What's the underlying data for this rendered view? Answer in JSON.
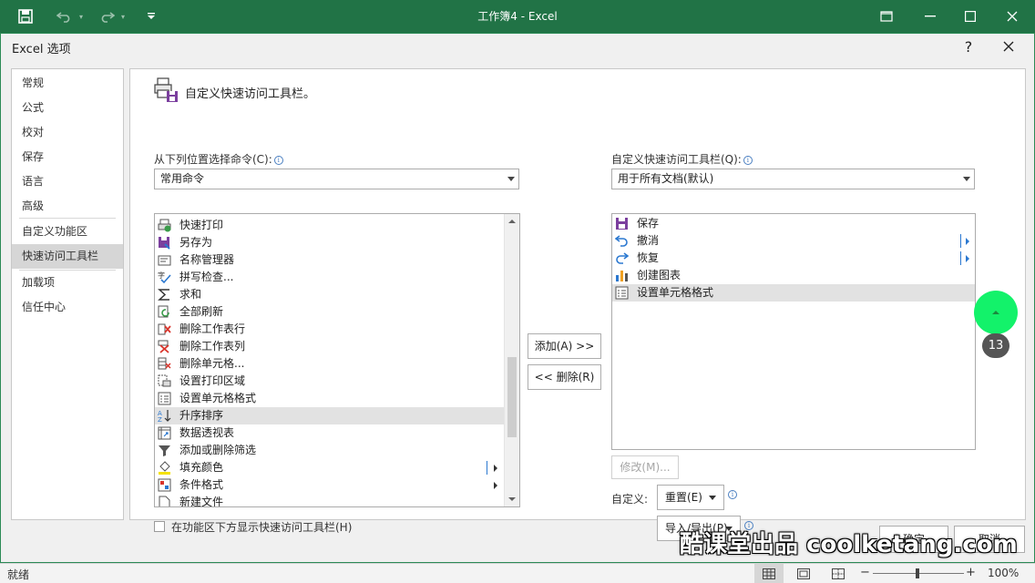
{
  "window": {
    "title": "工作簿4 - Excel",
    "accent_color": "#217346"
  },
  "dialog": {
    "title": "Excel 选项",
    "help_label": "?",
    "close_label": "✕"
  },
  "nav": {
    "items": [
      {
        "label": "常规"
      },
      {
        "label": "公式"
      },
      {
        "label": "校对"
      },
      {
        "label": "保存"
      },
      {
        "label": "语言"
      },
      {
        "label": "高级"
      },
      {
        "label": "自定义功能区"
      },
      {
        "label": "快速访问工具栏"
      },
      {
        "label": "加载项"
      },
      {
        "label": "信任中心"
      }
    ],
    "selected": "快速访问工具栏"
  },
  "content": {
    "heading": "自定义快速访问工具栏。",
    "choose_from_label": "从下列位置选择命令(C):",
    "choose_from_value": "常用命令",
    "customize_label": "自定义快速访问工具栏(Q):",
    "customize_value": "用于所有文档(默认)",
    "info_glyph": "i",
    "commands": [
      {
        "label": "快速打印",
        "icon": "quick-print-icon"
      },
      {
        "label": "另存为",
        "icon": "save-as-icon"
      },
      {
        "label": "名称管理器",
        "icon": "name-manager-icon"
      },
      {
        "label": "拼写检查...",
        "icon": "spell-check-icon"
      },
      {
        "label": "求和",
        "icon": "sum-icon"
      },
      {
        "label": "全部刷新",
        "icon": "refresh-all-icon"
      },
      {
        "label": "删除工作表行",
        "icon": "delete-row-icon"
      },
      {
        "label": "删除工作表列",
        "icon": "delete-column-icon"
      },
      {
        "label": "删除单元格...",
        "icon": "delete-cells-icon"
      },
      {
        "label": "设置打印区域",
        "icon": "print-area-icon"
      },
      {
        "label": "设置单元格格式",
        "icon": "format-cells-icon"
      },
      {
        "label": "升序排序",
        "icon": "sort-ascending-icon"
      },
      {
        "label": "数据透视表",
        "icon": "pivot-table-icon"
      },
      {
        "label": "添加或删除筛选",
        "icon": "filter-icon"
      },
      {
        "label": "填充颜色",
        "icon": "fill-color-icon"
      },
      {
        "label": "条件格式",
        "icon": "conditional-format-icon"
      },
      {
        "label": "新建文件",
        "icon": "new-file-icon"
      }
    ],
    "selected_command": "升序排序",
    "toolbar_items": [
      {
        "label": "保存",
        "icon": "save-icon"
      },
      {
        "label": "撤消",
        "icon": "undo-icon"
      },
      {
        "label": "恢复",
        "icon": "redo-icon"
      },
      {
        "label": "创建图表",
        "icon": "chart-icon"
      },
      {
        "label": "设置单元格格式",
        "icon": "format-cells-icon"
      }
    ],
    "selected_toolbar_item": "设置单元格格式",
    "add_label": "添加(A) >>",
    "remove_label": "<< 删除(R)",
    "modify_label": "修改(M)...",
    "customize_text_label": "自定义:",
    "reset_label": "重置(E)",
    "import_export_label": "导入/导出(P)",
    "show_below_label": "在功能区下方显示快速访问工具栏(H)"
  },
  "footer": {
    "ok_label": "确定",
    "cancel_label": "取消"
  },
  "statusbar": {
    "ready_label": "就绪",
    "zoom_minus": "−",
    "zoom_plus": "+",
    "zoom_level": "100%"
  },
  "overlay": {
    "step_number": "13",
    "watermark": "酷课堂出品 coolketang.com",
    "pointer_color": "#13f26a"
  }
}
